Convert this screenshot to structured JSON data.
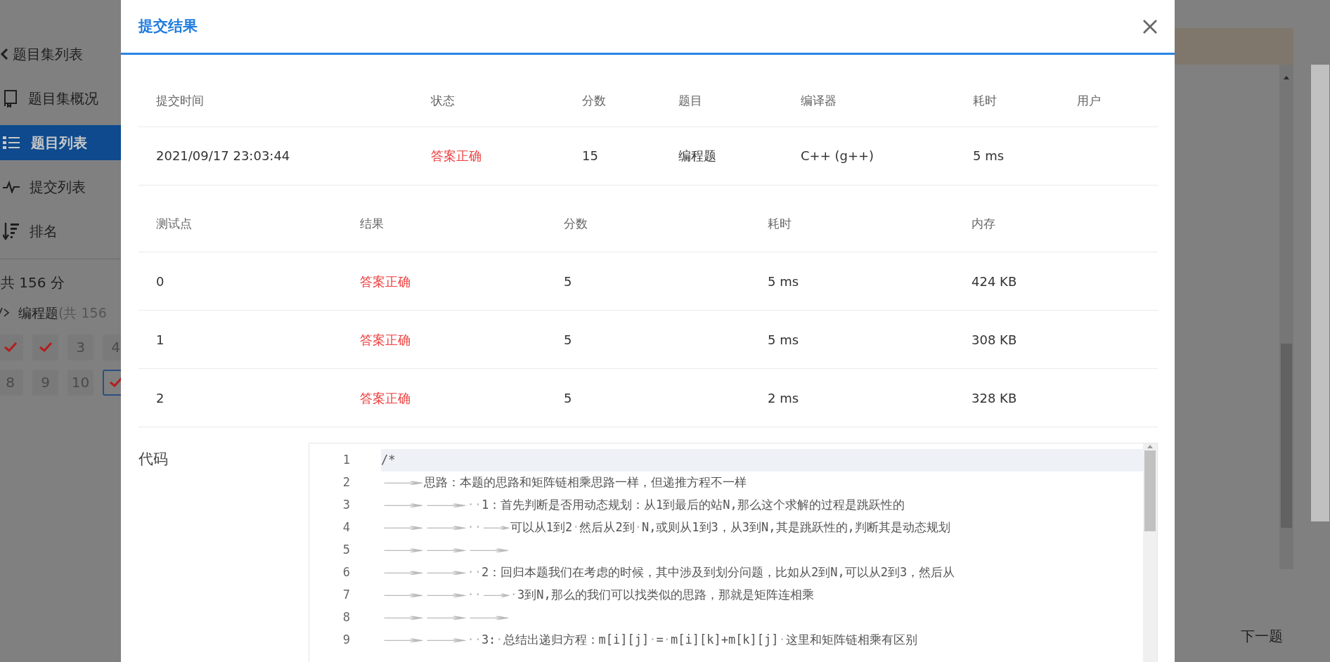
{
  "sidebar": {
    "items": [
      {
        "kind": "back",
        "label": "题目集列表",
        "selected": false
      },
      {
        "kind": "overview",
        "label": "题目集概况",
        "selected": false
      },
      {
        "kind": "list",
        "label": "题目列表",
        "selected": true
      },
      {
        "kind": "submissions",
        "label": "提交列表",
        "selected": false
      },
      {
        "kind": "ranking",
        "label": "排名",
        "selected": false
      }
    ],
    "score_total": "共 156 分",
    "section": {
      "label": "编程题",
      "note": "(共 156"
    },
    "problems": [
      {
        "solved": true,
        "selected": false
      },
      {
        "solved": true,
        "selected": false
      },
      {
        "label": "3",
        "solved": false,
        "selected": false
      },
      {
        "label": "4",
        "solved": false,
        "selected": false
      },
      {
        "label": "8",
        "solved": false,
        "selected": false
      },
      {
        "label": "9",
        "solved": false,
        "selected": false
      },
      {
        "label": "10",
        "solved": false,
        "selected": false
      },
      {
        "solved": true,
        "selected": true
      }
    ]
  },
  "modal": {
    "title": "提交结果",
    "summary": {
      "columns": [
        "提交时间",
        "状态",
        "分数",
        "题目",
        "编译器",
        "耗时",
        "用户"
      ],
      "row": [
        {
          "text": "2021/09/17 23:03:44"
        },
        {
          "text": "答案正确",
          "kind": "status"
        },
        {
          "text": "15"
        },
        {
          "text": "编程题"
        },
        {
          "text": "C++ (g++)"
        },
        {
          "text": "5 ms"
        }
      ]
    },
    "tests": {
      "columns": [
        "测试点",
        "结果",
        "分数",
        "耗时",
        "内存"
      ],
      "rows": [
        [
          "0",
          "答案正确",
          "5",
          "5 ms",
          "424 KB"
        ],
        [
          "1",
          "答案正确",
          "5",
          "5 ms",
          "308 KB"
        ],
        [
          "2",
          "答案正确",
          "5",
          "2 ms",
          "328 KB"
        ]
      ]
    },
    "code_label": "代码",
    "code_lines": [
      {
        "number": "1",
        "text": "/*",
        "current": true
      },
      {
        "number": "2",
        "text": "→思路：本题的思路和矩阵链相乘思路一样，但递推方程不一样",
        "current": false
      },
      {
        "number": "3",
        "text": "→→··1：首先判断是否用动态规划：从1到最后的站N,那么这个求解的过程是跳跃性的",
        "current": false
      },
      {
        "number": "4",
        "text": "→→··→可以从1到2·然后从2到·N,或则从1到3，从3到N,其是跳跃性的,判断其是动态规划",
        "current": false
      },
      {
        "number": "5",
        "text": "→→→",
        "current": false
      },
      {
        "number": "6",
        "text": "→→··2：回归本题我们在考虑的时候，其中涉及到划分问题，比如从2到N,可以从2到3，然后从",
        "current": false
      },
      {
        "number": "7",
        "text": "→→··→·3到N,那么的我们可以找类似的思路，那就是矩阵连相乘",
        "current": false
      },
      {
        "number": "8",
        "text": "→→→",
        "current": false
      },
      {
        "number": "9",
        "text": "→→··3:·总结出递归方程：m[i][j]·=·m[i][k]+m[k][j]·这里和矩阵链相乘有区别",
        "current": false
      }
    ]
  },
  "next_button": "下一题"
}
